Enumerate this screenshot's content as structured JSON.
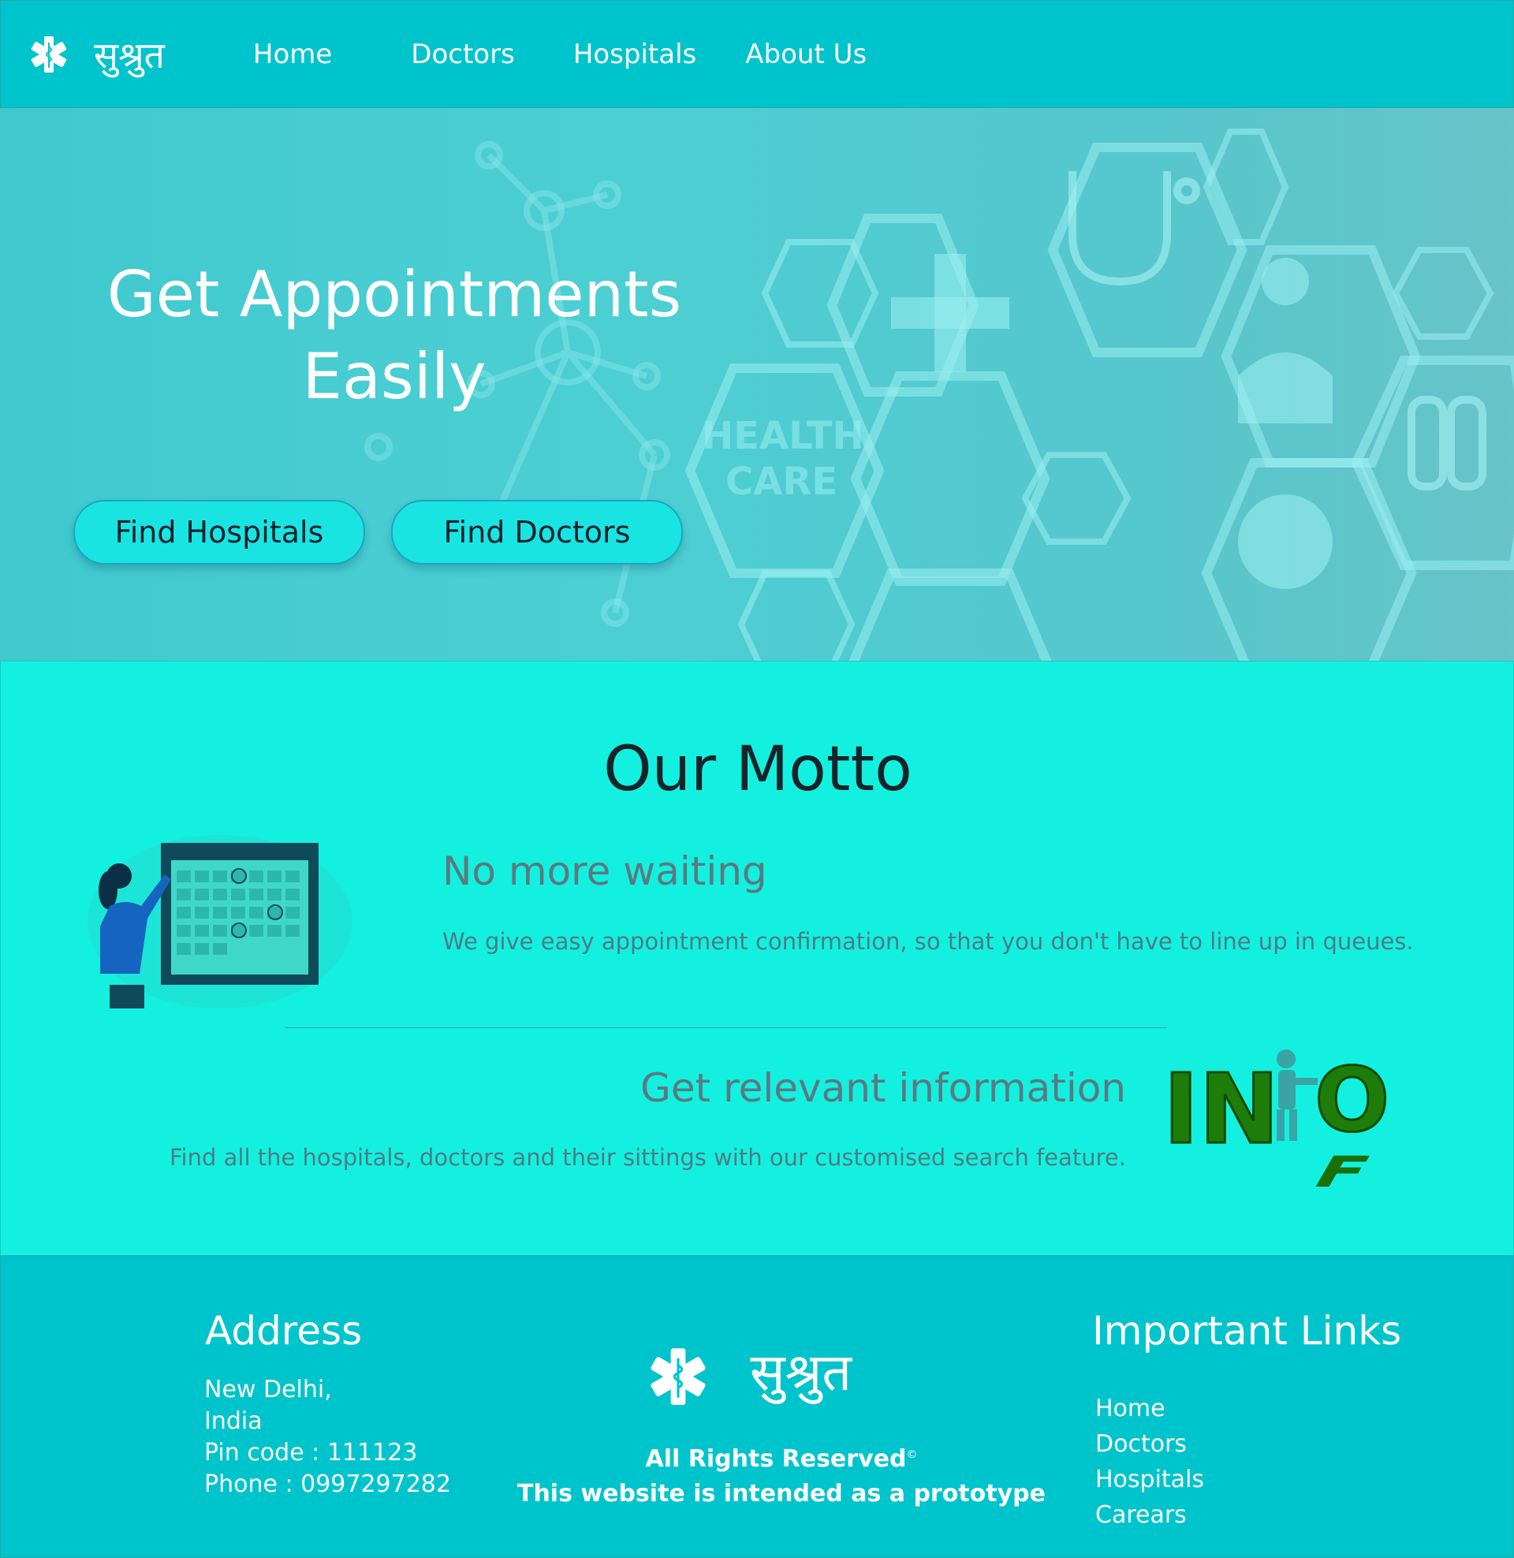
{
  "brand": {
    "name": "सुश्रुत"
  },
  "nav": {
    "links": [
      "Home",
      "Doctors",
      "Hospitals",
      "About Us"
    ]
  },
  "hero": {
    "title_line1": "Get Appointments",
    "title_line2": "Easily",
    "buttons": [
      "Find Hospitals",
      "Find Doctors"
    ],
    "art_text": {
      "health": "HEALTH",
      "care": "CARE"
    }
  },
  "motto": {
    "title": "Our Motto",
    "items": [
      {
        "heading": "No more waiting",
        "text": "We give easy appointment confirmation, so that you don't have to line up in queues."
      },
      {
        "heading": "Get relevant information",
        "text": "Find all the hospitals, doctors and their sittings with our customised search feature."
      }
    ],
    "info_art": {
      "letters_top": "IN",
      "letter_o": "O",
      "letter_f": "F"
    }
  },
  "footer": {
    "address": {
      "heading": "Address",
      "lines": [
        "New Delhi,",
        "India",
        "Pin code : 111123",
        "Phone : 0997297282"
      ]
    },
    "brand_name": "सुश्रुत",
    "rights": "All Rights Reserved",
    "rights_symbol": "©",
    "prototype_note": "This website is intended as a prototype",
    "links": {
      "heading": "Important Links",
      "items": [
        "Home",
        "Doctors",
        "Hospitals",
        "Carears"
      ]
    }
  },
  "colors": {
    "primary": "#00c4cc",
    "section": "#14f0e0",
    "button": "#1ae4e2",
    "text_dark": "#16242a",
    "text_muted": "#5a7a80"
  },
  "icons": [
    "star-of-life-icon"
  ]
}
